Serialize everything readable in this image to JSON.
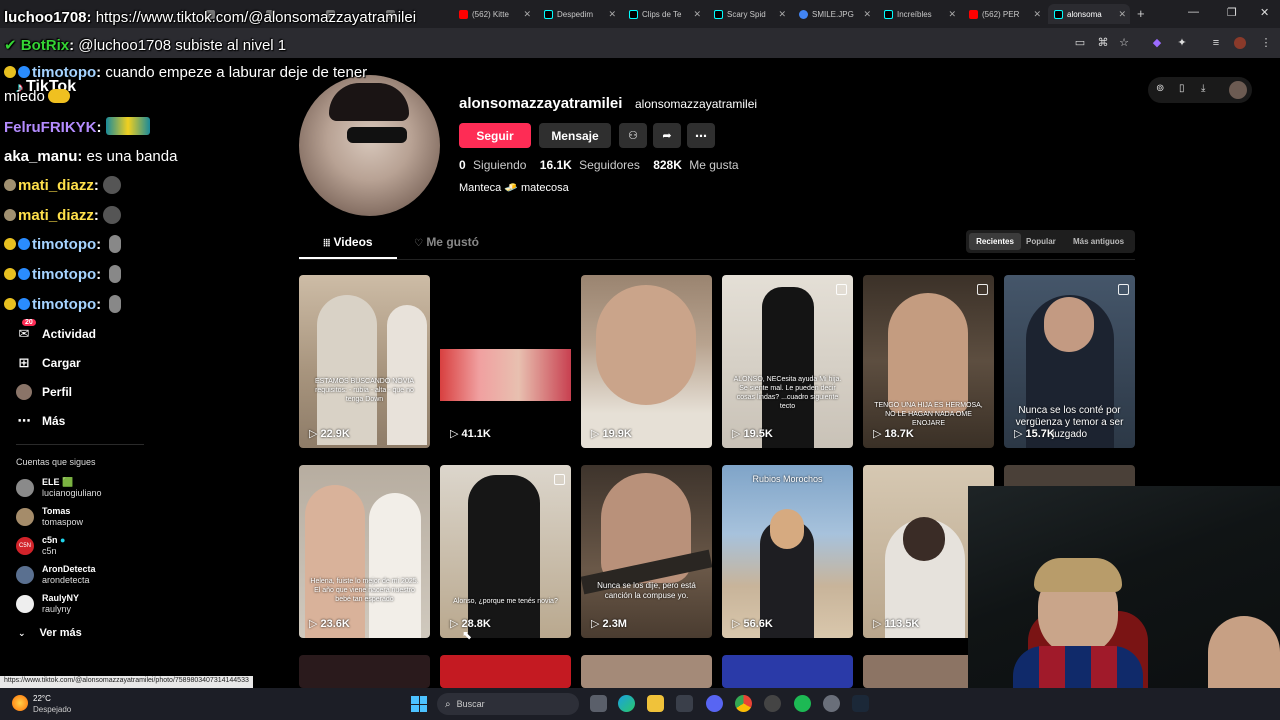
{
  "browser": {
    "tabs": [
      {
        "label": "",
        "color": "#777"
      },
      {
        "label": "",
        "color": "#777"
      },
      {
        "label": "",
        "color": "#777"
      },
      {
        "label": "",
        "color": "#777"
      },
      {
        "label": "(562) Kitte",
        "color": "#ff0000"
      },
      {
        "label": "Despedim",
        "color": "#222"
      },
      {
        "label": "Clips de Te",
        "color": "#222"
      },
      {
        "label": "Scary Spid",
        "color": "#222"
      },
      {
        "label": "SMILE.JPG",
        "color": "#4285f4"
      },
      {
        "label": "Increíbles",
        "color": "#222"
      },
      {
        "label": "(562) PER",
        "color": "#ff0000"
      },
      {
        "label": "alonsoma",
        "color": "#222"
      }
    ],
    "new_tab": "+",
    "minimize": "—",
    "restore": "❐",
    "close": "✕"
  },
  "chat": [
    {
      "user": "luchoo1708",
      "text": "https://www.tiktok.com/@alonsomazzayatramilei",
      "user_color": "#ffffff"
    },
    {
      "user": "BotRix",
      "text": "@luchoo1708 subiste al nivel 1",
      "user_color": "#35d435"
    },
    {
      "user": "timotopo",
      "text": "cuando empeze a laburar deje de tener",
      "user_color": "#a5d3ff"
    },
    {
      "user": "",
      "text": "miedo",
      "user_color": "#ffffff"
    },
    {
      "user": "FelruFRIKYK",
      "text": "",
      "user_color": "#b48cff"
    },
    {
      "user": "aka_manu",
      "text": "es una banda",
      "user_color": "#ffffff"
    },
    {
      "user": "mati_diazz",
      "text": "",
      "user_color": "#ffe04a"
    },
    {
      "user": "mati_diazz",
      "text": "",
      "user_color": "#ffe04a"
    },
    {
      "user": "timotopo",
      "text": "",
      "user_color": "#a5d3ff"
    },
    {
      "user": "timotopo",
      "text": "",
      "user_color": "#a5d3ff"
    },
    {
      "user": "timotopo",
      "text": "",
      "user_color": "#a5d3ff"
    }
  ],
  "tiktok": {
    "logo": "TikTok",
    "nav": [
      {
        "label": "Actividad",
        "icon": "inbox-icon",
        "badge": "20"
      },
      {
        "label": "Cargar",
        "icon": "plus-square-icon"
      },
      {
        "label": "Perfil",
        "icon": "avatar-icon"
      },
      {
        "label": "Más",
        "icon": "more-icon"
      }
    ],
    "following_title": "Cuentas que sigues",
    "following": [
      {
        "name": "ELE 🟩",
        "handle": "lucianogiuliano",
        "color": "#8a8a8a"
      },
      {
        "name": "Tomas",
        "handle": "tomaspow",
        "color": "#a58c6a"
      },
      {
        "name": "c5n",
        "handle": "c5n",
        "color": "#d2232a"
      },
      {
        "name": "AronDetecta",
        "handle": "arondetecta",
        "color": "#5a7090"
      },
      {
        "name": "RaulyNY",
        "handle": "raulyny",
        "color": "#eeeeee"
      }
    ],
    "see_more": "Ver más"
  },
  "profile": {
    "name": "alonsomazzayatramilei",
    "handle": "alonsomazzayatramilei",
    "follow_label": "Seguir",
    "message_label": "Mensaje",
    "following_count": "0",
    "following_label": "Siguiendo",
    "followers_count": "16.1K",
    "followers_label": "Seguidores",
    "likes_count": "828K",
    "likes_label": "Me gusta",
    "bio": "Manteca 🧈 matecosa",
    "tabs": [
      "Videos",
      "Me gustó"
    ],
    "sort": [
      "Recientes",
      "Popular",
      "Más antiguos"
    ]
  },
  "videos": [
    {
      "views": "22.9K",
      "caption": "ESTAMOS BUSCANDO NOVIA requisitos: - rubia - alta - que no tenga Down",
      "bg": "#b8a690"
    },
    {
      "views": "41.1K",
      "caption": "",
      "bg": "#000000"
    },
    {
      "views": "19.9K",
      "caption": "",
      "bg": "#8f7a6c"
    },
    {
      "views": "19.5K",
      "caption": "ALONSO, NECesita ayuda Mi hija. Se siente mal. Le pueden decir cosas lindas? ...cuadro siguiente tecto",
      "bg": "#6e655c"
    },
    {
      "views": "18.7K",
      "caption": "TENGO UNA HIJA ES HERMOSA, NO LE HAGAN NADA OME ENOJARE",
      "bg": "#4f4438"
    },
    {
      "views": "15.7K",
      "caption": "Nunca se los conté por vergüenza y temor a ser juzgado",
      "bg": "#3c4b5c"
    },
    {
      "views": "23.6K",
      "caption": "Helena, fuiste lo mejor de mi 2025. El año que viene nacerá nuestro bebé tan esperado",
      "bg": "#a89c8c"
    },
    {
      "views": "28.8K",
      "caption": "Alonso, ¿porque me tenés novia?",
      "bg": "#5d5448"
    },
    {
      "views": "2.3M",
      "caption": "Nunca se los dije, pero está canción la compuse yo.",
      "bg": "#5a4c40"
    },
    {
      "views": "56.6K",
      "caption": "Rubios        Morochos",
      "bg": "#6d8aa8"
    },
    {
      "views": "113.5K",
      "caption": "",
      "bg": "#9c8a74"
    },
    {
      "views": "",
      "caption": "",
      "bg": "#3a3a3a"
    }
  ],
  "status_url": "https://www.tiktok.com/@alonsomazzayatramilei/photo/7589803407314144533",
  "taskbar": {
    "weather_temp": "22°C",
    "weather_desc": "Despejado",
    "search_placeholder": "Buscar"
  }
}
